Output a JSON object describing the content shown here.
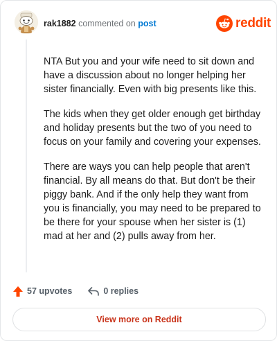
{
  "header": {
    "username": "rak1882",
    "action_text": "commented on",
    "post_link": "post",
    "brand": "reddit",
    "avatar_icon": "snoo-avatar-icon",
    "brand_icon": "reddit-logo-icon"
  },
  "comment": {
    "paragraphs": [
      "NTA But you and your wife need to sit down and have a discussion about no longer helping her sister financially. Even with big presents like this.",
      "The kids when they get older enough get birthday and holiday presents but the two of you need to focus on your family and covering your expenses.",
      "There are ways you can help people that aren't financial. By all means do that. But don't be their piggy bank. And if the only help they want from you is financially, you may need to be prepared to be there for your spouse when her sister is (1) mad at her and (2) pulls away from her."
    ]
  },
  "footer": {
    "upvotes": "57 upvotes",
    "replies": "0 replies",
    "view_more": "View more on Reddit",
    "upvote_icon": "upvote-arrow-icon",
    "reply_icon": "reply-arrow-icon"
  },
  "colors": {
    "brand": "#ff4500",
    "link": "#0079d3",
    "view_more": "#c9341b"
  }
}
